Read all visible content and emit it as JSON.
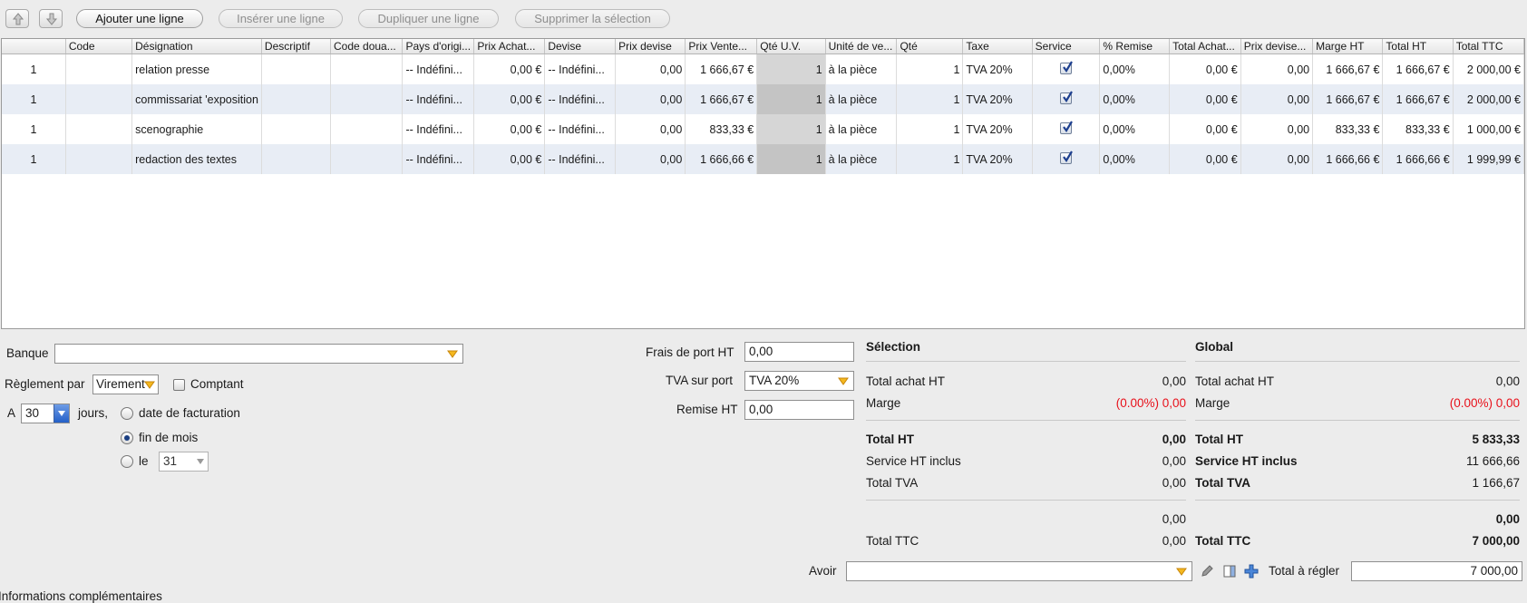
{
  "toolbar": {
    "add": "Ajouter une ligne",
    "insert": "Insérer une ligne",
    "duplicate": "Dupliquer une ligne",
    "delete": "Supprimer la sélection"
  },
  "table": {
    "columns": [
      "",
      "Code",
      "Désignation",
      "Descriptif",
      "Code doua...",
      "Pays d'origi...",
      "Prix Achat...",
      "Devise",
      "Prix devise",
      "Prix Vente...",
      "Qté U.V.",
      "Unité de ve...",
      "Qté",
      "Taxe",
      "Service",
      "% Remise",
      "Total Achat...",
      "Prix devise...",
      "Marge HT",
      "Total HT",
      "Total TTC"
    ],
    "rows": [
      {
        "n": "1",
        "code": "",
        "designation": "relation presse",
        "descriptif": "",
        "douane": "",
        "pays": "-- Indéfini...",
        "achat": "0,00 €",
        "devise": "-- Indéfini...",
        "prixdevise": "0,00",
        "vente": "1 666,67 €",
        "qteuv": "1",
        "unite": "à la pièce",
        "qte": "1",
        "taxe": "TVA 20%",
        "remise": "0,00%",
        "totalachat": "0,00 €",
        "prixdevise2": "0,00",
        "marge": "1 666,67 €",
        "totalht": "1 666,67 €",
        "totalttc": "2 000,00 €"
      },
      {
        "n": "1",
        "code": "",
        "designation": "commissariat 'exposition",
        "descriptif": "",
        "douane": "",
        "pays": "-- Indéfini...",
        "achat": "0,00 €",
        "devise": "-- Indéfini...",
        "prixdevise": "0,00",
        "vente": "1 666,67 €",
        "qteuv": "1",
        "unite": "à la pièce",
        "qte": "1",
        "taxe": "TVA 20%",
        "remise": "0,00%",
        "totalachat": "0,00 €",
        "prixdevise2": "0,00",
        "marge": "1 666,67 €",
        "totalht": "1 666,67 €",
        "totalttc": "2 000,00 €"
      },
      {
        "n": "1",
        "code": "",
        "designation": "scenographie",
        "descriptif": "",
        "douane": "",
        "pays": "-- Indéfini...",
        "achat": "0,00 €",
        "devise": "-- Indéfini...",
        "prixdevise": "0,00",
        "vente": "833,33 €",
        "qteuv": "1",
        "unite": "à la pièce",
        "qte": "1",
        "taxe": "TVA 20%",
        "remise": "0,00%",
        "totalachat": "0,00 €",
        "prixdevise2": "0,00",
        "marge": "833,33 €",
        "totalht": "833,33 €",
        "totalttc": "1 000,00 €"
      },
      {
        "n": "1",
        "code": "",
        "designation": "redaction des textes",
        "descriptif": "",
        "douane": "",
        "pays": "-- Indéfini...",
        "achat": "0,00 €",
        "devise": "-- Indéfini...",
        "prixdevise": "0,00",
        "vente": "1 666,66 €",
        "qteuv": "1",
        "unite": "à la pièce",
        "qte": "1",
        "taxe": "TVA 20%",
        "remise": "0,00%",
        "totalachat": "0,00 €",
        "prixdevise2": "0,00",
        "marge": "1 666,66 €",
        "totalht": "1 666,66 €",
        "totalttc": "1 999,99 €"
      }
    ]
  },
  "payment": {
    "banque_label": "Banque",
    "banque_value": "",
    "reglement_label": "Règlement par",
    "reglement_value": "Virement",
    "comptant_label": "Comptant",
    "a_label": "A",
    "days_value": "30",
    "jours_label": "jours,",
    "opt_facturation": "date de facturation",
    "opt_fin_mois": "fin de mois",
    "opt_le": "le",
    "le_value": "31"
  },
  "port": {
    "frais_label": "Frais de port HT",
    "frais_value": "0,00",
    "tva_label": "TVA sur port",
    "tva_value": "TVA 20%",
    "remise_label": "Remise HT",
    "remise_value": "0,00"
  },
  "selection": {
    "title": "Sélection",
    "achat_label": "Total achat HT",
    "achat_value": "0,00",
    "marge_label": "Marge",
    "marge_value": "(0.00%) 0,00",
    "ht_label": "Total HT",
    "ht_value": "0,00",
    "service_label": "Service HT inclus",
    "service_value": "0,00",
    "tva_label": "Total TVA",
    "tva_value": "0,00",
    "blank_value": "0,00",
    "ttc_label": "Total TTC",
    "ttc_value": "0,00"
  },
  "global": {
    "title": "Global",
    "achat_label": "Total achat HT",
    "achat_value": "0,00",
    "marge_label": "Marge",
    "marge_value": "(0.00%) 0,00",
    "ht_label": "Total HT",
    "ht_value": "5 833,33",
    "service_label": "Service HT inclus",
    "service_value": "11 666,66",
    "tva_label": "Total TVA",
    "tva_value": "1 166,67",
    "blank_value": "0,00",
    "ttc_label": "Total TTC",
    "ttc_value": "7 000,00"
  },
  "footer": {
    "avoir_label": "Avoir",
    "avoir_value": "",
    "regler_label": "Total à régler",
    "regler_value": "7 000,00",
    "info_label": "Informations complémentaires"
  },
  "colors": {
    "accent": "#2460c8",
    "negative": "#e8101a",
    "row_alt": "#e8edf5"
  }
}
